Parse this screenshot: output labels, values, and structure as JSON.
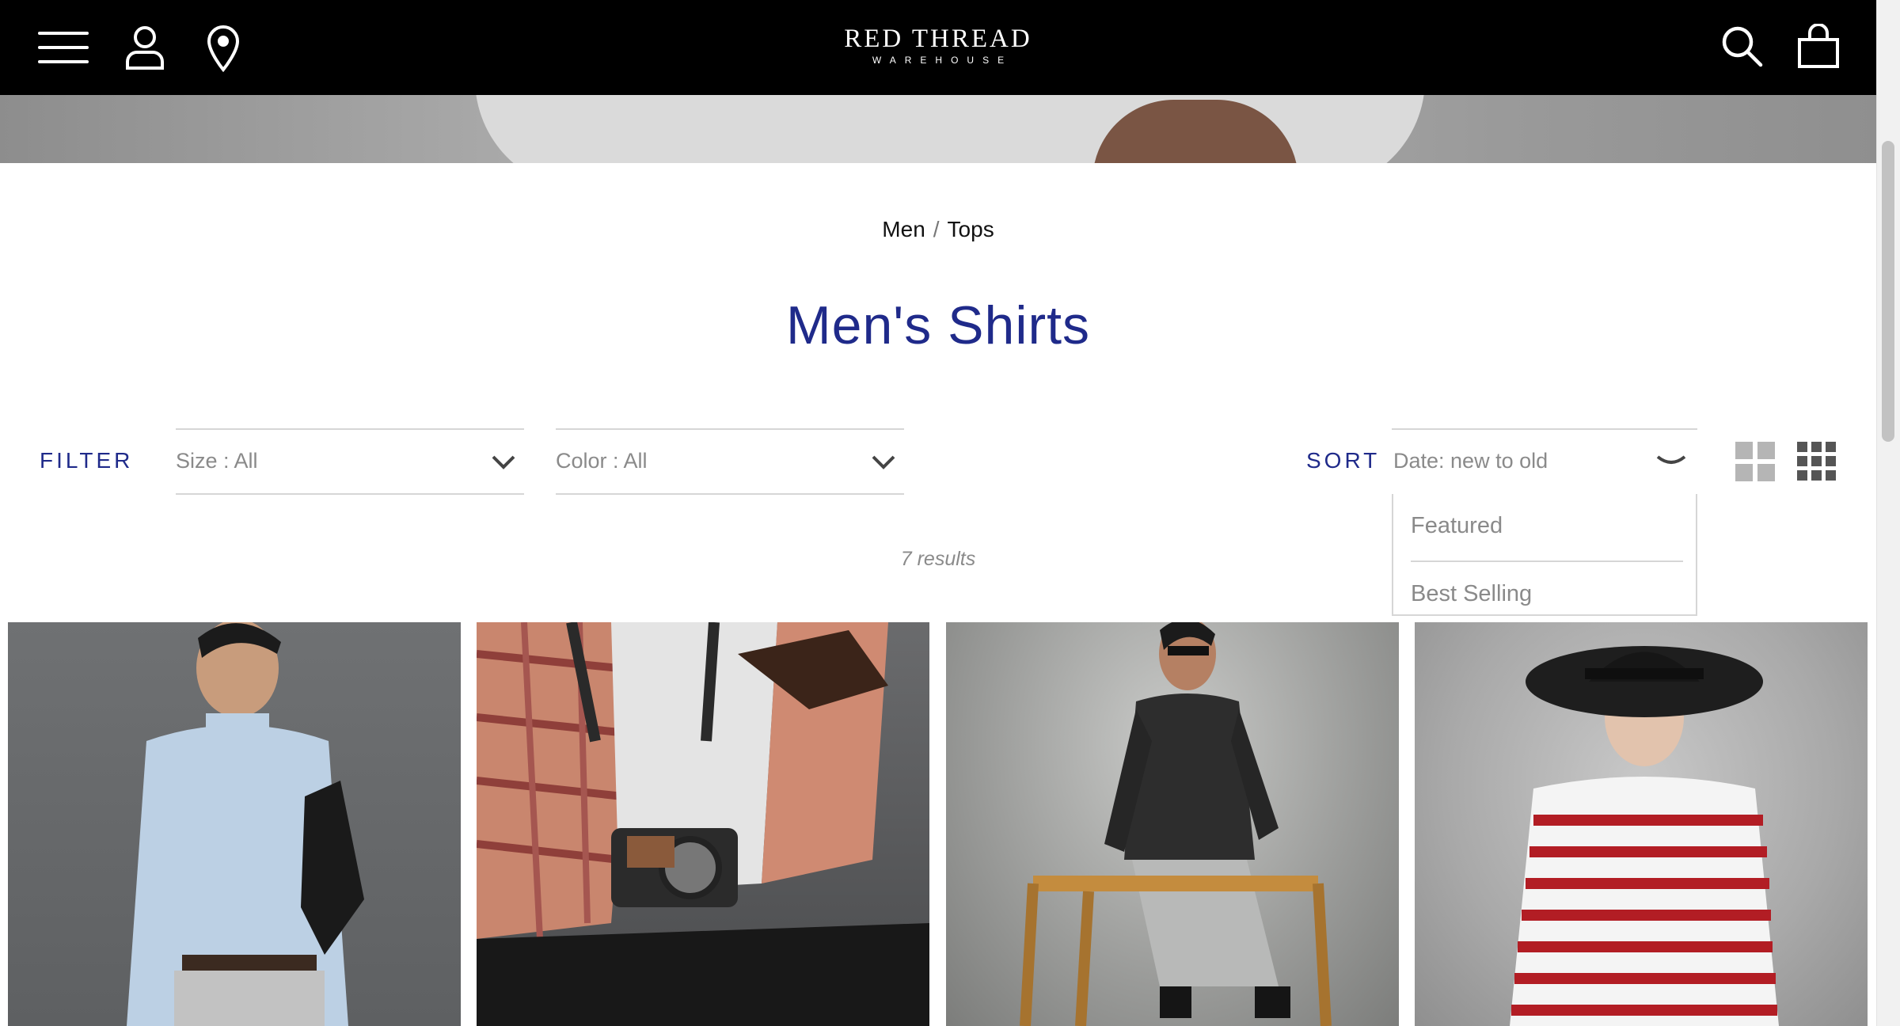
{
  "brand": {
    "name": "RED THREAD",
    "tagline": "WAREHOUSE"
  },
  "header_icons": [
    "menu-icon",
    "account-icon",
    "location-pin-icon",
    "search-icon",
    "shopping-bag-icon"
  ],
  "breadcrumb": {
    "items": [
      "Men",
      "Tops"
    ],
    "separator": "/"
  },
  "page": {
    "title": "Men's Shirts"
  },
  "filters": {
    "label": "FILTER",
    "size": {
      "value": "Size : All"
    },
    "color": {
      "value": "Color : All"
    }
  },
  "sort": {
    "label": "SORT",
    "selected": "Date: new to old",
    "options": [
      "Featured",
      "Best Selling"
    ]
  },
  "results_text": "7 results",
  "colors": {
    "accent": "#1f2a8a",
    "header_bg": "#000000",
    "muted_text": "#8a8a8a"
  }
}
